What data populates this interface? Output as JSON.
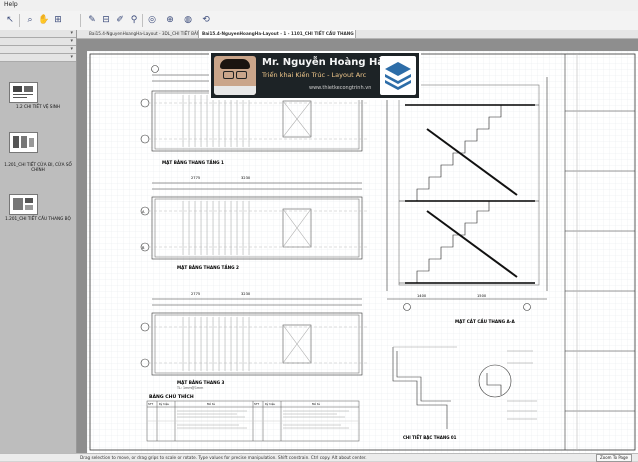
{
  "menu": {
    "help_label": "Help"
  },
  "toolbar": {
    "icons": [
      "select-icon",
      "zoom-icon",
      "pan-icon",
      "sheet-tools-icon",
      "pencil-icon",
      "tape-icon",
      "marker-icon",
      "stamp-icon",
      "link-icon",
      "target-icon",
      "fit-icon",
      "rotate-icon"
    ]
  },
  "tabs": [
    {
      "label": "Bai15.4-NguyenHoangHa-Layout - 3DL_CHI TIẾT BẢN TANG",
      "active": false
    },
    {
      "label": "Bai15.4-NguyenHoangHa-Layout - 1 - 1101_CHI TIẾT CẦU THANG BỘ",
      "active": true
    }
  ],
  "sheets": [
    {
      "label": "1.2 CHI TIẾT VỆ SINH"
    },
    {
      "label": "1.201_CHI TIẾT CỬA ĐI, CỬA SỔ CHÍNH"
    },
    {
      "label": "1.201_CHI TIẾT CẦU THANG BỘ"
    }
  ],
  "promo": {
    "name": "Mr. Nguyễn Hoàng Hà",
    "subtitle": "Triển khai Kiến Trúc - Layout Arc",
    "website": "www.thietkecongtrinh.vn"
  },
  "drawing": {
    "plan1_title": "MẶT BẰNG THANG TẦNG 1",
    "plan2_title": "MẶT BẰNG THANG TẦNG 2",
    "plan3_title": "MẶT BẰNG THANG 3",
    "scale_note": "TL: 1mm@1mm",
    "section_title": "MẶT CẮT CẦU THANG A-A",
    "detail_title": "CHI TIẾT BẬC THANG 01",
    "legend_title": "BẢNG CHÚ THÍCH",
    "legend_headers": [
      "STT",
      "Ký hiệu",
      "Mô tả",
      "STT",
      "Ký hiệu",
      "Mô tả"
    ],
    "dim_a": "2775",
    "dim_b": "3230",
    "dim_c": "1400",
    "dim_d": "1500",
    "axis_a": "A",
    "axis_b": "B"
  },
  "status": {
    "text": "Drag selection to move, or drag grips to scale or rotate. Type values for precise manipulation. Shift constrain. Ctrl copy. Alt about center.",
    "zoom_label": "Zoom To Page"
  }
}
